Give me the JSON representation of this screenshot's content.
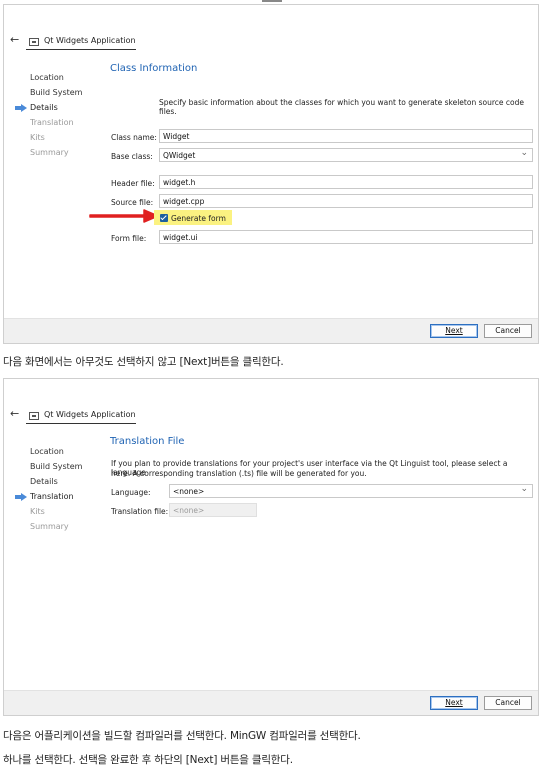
{
  "window1": {
    "app_title": "Qt Widgets Application",
    "steps": [
      {
        "label": "Location",
        "state": "done"
      },
      {
        "label": "Build System",
        "state": "done"
      },
      {
        "label": "Details",
        "state": "current"
      },
      {
        "label": "Translation",
        "state": "future"
      },
      {
        "label": "Kits",
        "state": "future"
      },
      {
        "label": "Summary",
        "state": "future"
      }
    ],
    "page_title": "Class Information",
    "description": "Specify basic information about the classes for which you want to generate skeleton source code files.",
    "class_name_label": "Class name:",
    "class_name_value": "Widget",
    "base_class_label": "Base class:",
    "base_class_value": "QWidget",
    "header_file_label": "Header file:",
    "header_file_value": "widget.h",
    "source_file_label": "Source file:",
    "source_file_value": "widget.cpp",
    "generate_form_label": "Generate form",
    "generate_form_checked": true,
    "form_file_label": "Form file:",
    "form_file_value": "widget.ui",
    "next_label": "Next",
    "cancel_label": "Cancel"
  },
  "caption1": "다음 화면에서는 아무것도 선택하지 않고 [Next]버튼을 클릭한다.",
  "window2": {
    "app_title": "Qt Widgets Application",
    "steps": [
      {
        "label": "Location",
        "state": "done"
      },
      {
        "label": "Build System",
        "state": "done"
      },
      {
        "label": "Details",
        "state": "done"
      },
      {
        "label": "Translation",
        "state": "current"
      },
      {
        "label": "Kits",
        "state": "future"
      },
      {
        "label": "Summary",
        "state": "future"
      }
    ],
    "page_title": "Translation File",
    "description_line1": "If you plan to provide translations for your project's user interface via the Qt Linguist tool, please select a language",
    "description_line2": "here. A corresponding translation (.ts) file will be generated for you.",
    "language_label": "Language:",
    "language_value": "<none>",
    "translation_file_label": "Translation file:",
    "translation_file_value": "<none>",
    "next_label": "Next",
    "cancel_label": "Cancel"
  },
  "caption2_line1": "다음은 어플리케이션을 빌드할 컴파일러를 선택한다. MinGW 컴파일러를 선택한다.",
  "caption2_line2": "하나를 선택한다. 선택을 완료한 후 하단의 [Next] 버튼을 클릭한다.",
  "colors": {
    "accent": "#1f63b3",
    "highlight": "#fbf281",
    "annotation_arrow": "#e02020",
    "step_indicator": "#4a8ad8"
  }
}
